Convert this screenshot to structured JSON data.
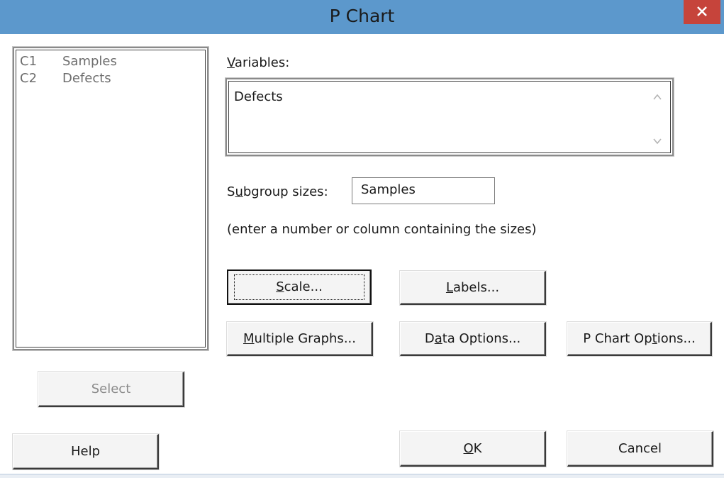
{
  "window": {
    "title": "P Chart",
    "close_glyph": "✕"
  },
  "columns": [
    {
      "id": "C1",
      "name": "Samples"
    },
    {
      "id": "C2",
      "name": "Defects"
    }
  ],
  "variables": {
    "label_mnemonic": "V",
    "label_rest": "ariables:",
    "value": "Defects"
  },
  "subgroup": {
    "label_pre": "S",
    "label_mnemonic": "u",
    "label_rest": "bgroup sizes:",
    "value": "Samples",
    "hint": "(enter a number or column containing the sizes)"
  },
  "buttons": {
    "scale": {
      "mnemonic": "S",
      "rest": "cale..."
    },
    "labels": {
      "mnemonic": "L",
      "rest": "abels..."
    },
    "multiple_graphs": {
      "mnemonic": "M",
      "rest": "ultiple Graphs..."
    },
    "data_options": {
      "pre": "D",
      "mnemonic": "a",
      "rest": "ta Options..."
    },
    "p_chart_options": {
      "pre": "P Chart Op",
      "mnemonic": "t",
      "rest": "ions..."
    },
    "select": "Select",
    "help": "Help",
    "ok": {
      "mnemonic": "O",
      "rest": "K"
    },
    "cancel": "Cancel"
  },
  "icons": {
    "close": "close-icon",
    "scroll_up": "chevron-up-icon",
    "scroll_down": "chevron-down-icon"
  },
  "colors": {
    "titlebar": "#5c98cc",
    "close_button": "#c6443b"
  }
}
